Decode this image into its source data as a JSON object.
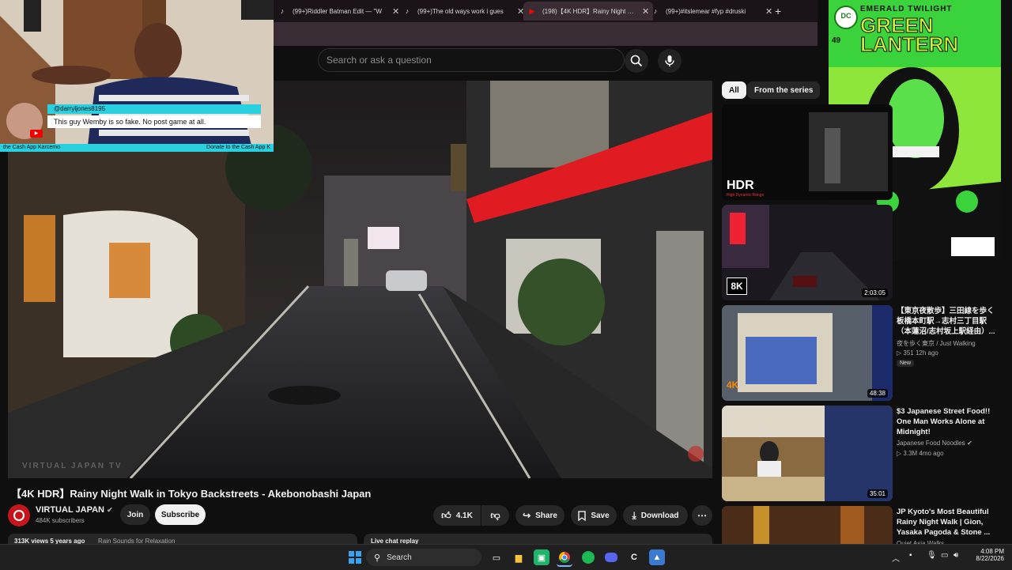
{
  "browser": {
    "tabs": [
      {
        "label": "(99+)Riddler Batman Edit — \"W",
        "icon": "tiktok-icon",
        "active": false
      },
      {
        "label": "(99+)The old ways work i gues",
        "icon": "tiktok-icon",
        "active": false
      },
      {
        "label": "(198)【4K HDR】Rainy Night Wa",
        "icon": "youtube-icon",
        "active": true
      },
      {
        "label": "(99+)#itslemear #fyp #druski",
        "icon": "tiktok-icon",
        "active": false
      }
    ],
    "new_tab": "+"
  },
  "youtube": {
    "search_placeholder": "Search or ask a question",
    "chips": [
      "All",
      "From the series"
    ],
    "video": {
      "watermark": "VIRTUAL JAPAN TV",
      "title": "【4K HDR】Rainy Night Walk in Tokyo Backstreets - Akebonobashi Japan",
      "channel": "VIRTUAL JAPAN",
      "subscribers": "484K subscribers",
      "join": "Join",
      "subscribe": "Subscribe",
      "likes": "4.1K",
      "share": "Share",
      "save": "Save",
      "download": "Download",
      "meta": "313K views  5 years ago",
      "meta_link": "Rain Sounds for Relaxation",
      "live_chat": "Live chat replay"
    },
    "sidebar": [
      {
        "thumb_label": "HDR",
        "thumb_sub": "High Dynamic Range",
        "duration": "",
        "title": "",
        "channel": "",
        "meta": ""
      },
      {
        "thumb_label": "8K",
        "duration": "2:03:05",
        "title": "",
        "channel": "",
        "meta": ""
      },
      {
        "thumb_label": "4K",
        "duration": "48:38",
        "title": "【東京夜散歩】三田線を歩く 板橋本町駅→志村三丁目駅（本蓮沼/志村坂上駅経由）...",
        "channel": "夜を歩く東京 / Just Walking",
        "meta": "351  12h ago",
        "badge": "New"
      },
      {
        "thumb_label": "",
        "duration": "35:01",
        "title": "$3 Japanese Street Food!! One Man Works Alone at Midnight!",
        "channel": "Japanese Food Noodles",
        "meta": "3.3M  4mo ago"
      },
      {
        "thumb_label": "",
        "duration": "",
        "title": "JP Kyoto's Most Beautiful Rainy Night Walk | Gion, Yasaka Pagoda & Stone ...",
        "channel": "Quiet Asia Walks",
        "meta": ""
      }
    ]
  },
  "webcam": {
    "chat_user": "@darryljones8195",
    "chat_message": "This guy Wemby is so fake. No post game at all.",
    "footer_left": "the Cash App Karcemo",
    "footer_right": "Donate to the Cash App K"
  },
  "comic": {
    "series_top": "EMERALD TWILIGHT",
    "title": "GREEN LANTERN",
    "issue": "49",
    "badge": "DC"
  },
  "taskbar": {
    "search": "Search",
    "time": "4:08 PM",
    "date": "8/22/2026"
  },
  "colors": {
    "accent_cyan": "#28d0e0",
    "youtube_red": "#ff0000",
    "lantern_green": "#39d23a"
  }
}
